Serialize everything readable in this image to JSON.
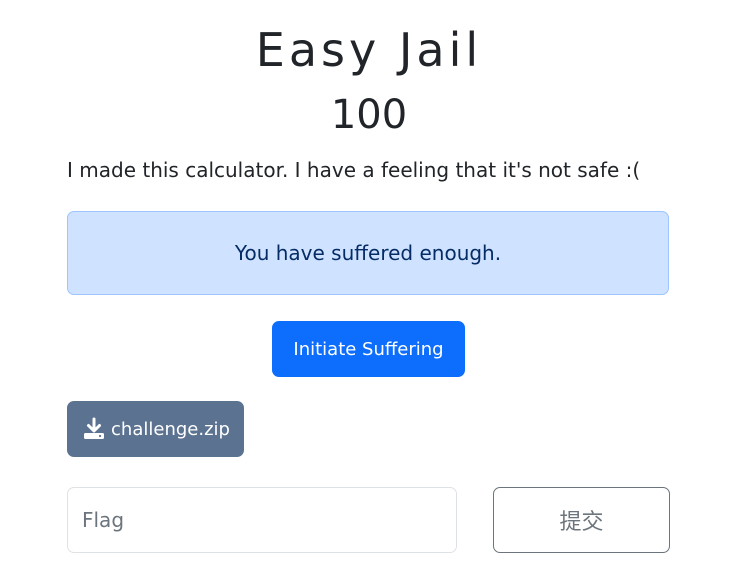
{
  "challenge": {
    "title": "Easy Jail",
    "points": "100",
    "description": "I made this calculator. I have a feeling that it's not safe :("
  },
  "alert": {
    "message": "You have suffered enough."
  },
  "actions": {
    "initiate_label": "Initiate Suffering",
    "download_label": "challenge.zip",
    "download_icon": "download-icon"
  },
  "flag_form": {
    "placeholder": "Flag",
    "value": "",
    "submit_label": "提交"
  },
  "colors": {
    "primary": "#0d6efd",
    "secondary": "#5c7291",
    "alert_bg": "#cfe2ff",
    "alert_text": "#052c65"
  }
}
